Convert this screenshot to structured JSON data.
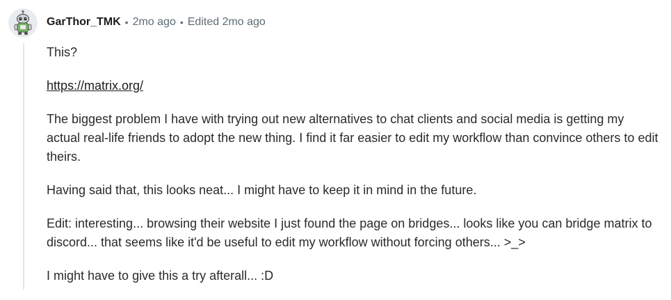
{
  "comment": {
    "author": "GarThor_TMK",
    "posted": "2mo ago",
    "edited": "Edited 2mo ago",
    "avatar_icon": "snoo-robot-avatar-icon",
    "paragraphs": {
      "p1": "This?",
      "link": "https://matrix.org/",
      "p3": "The biggest problem I have with trying out new alternatives to chat clients and social media is getting my actual real-life friends to adopt the new thing. I find it far easier to edit my workflow than convince others to edit theirs.",
      "p4": "Having said that, this looks neat... I might have to keep it in mind in the future.",
      "p5": "Edit: interesting... browsing their website I just found the page on bridges... looks like you can bridge matrix to discord... that seems like it'd be useful to edit my workflow without forcing others... >_>",
      "p6": "I might have to give this a try afterall... :D"
    }
  },
  "colors": {
    "text": "#1c1c1c",
    "meta": "#5c6c74",
    "thread_line": "#e5e6e8"
  }
}
